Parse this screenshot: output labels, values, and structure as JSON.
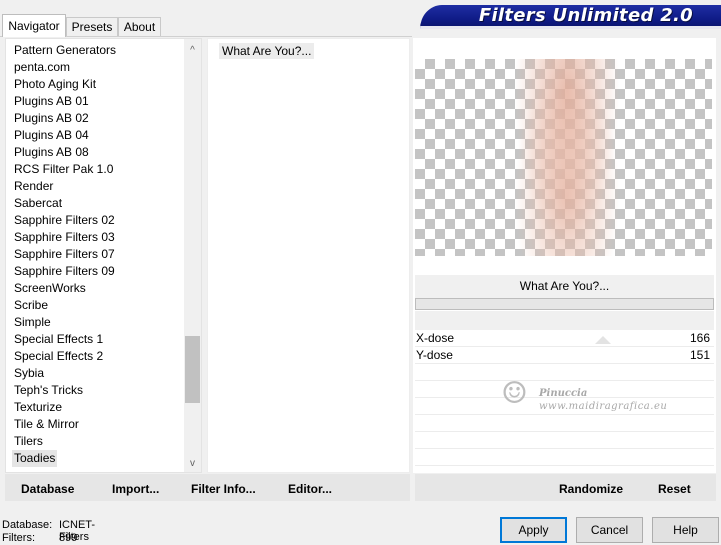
{
  "tabs": [
    {
      "label": "Navigator",
      "active": true
    },
    {
      "label": "Presets",
      "active": false
    },
    {
      "label": "About",
      "active": false
    }
  ],
  "banner": {
    "title": "Filters Unlimited 2.0"
  },
  "categories": {
    "items": [
      "Pattern Generators",
      "penta.com",
      "Photo Aging Kit",
      "Plugins AB 01",
      "Plugins AB 02",
      "Plugins AB 04",
      "Plugins AB 08",
      "RCS Filter Pak 1.0",
      "Render",
      "Sabercat",
      "Sapphire Filters 02",
      "Sapphire Filters 03",
      "Sapphire Filters 07",
      "Sapphire Filters 09",
      "ScreenWorks",
      "Scribe",
      "Simple",
      "Special Effects 1",
      "Special Effects 2",
      "Sybia",
      "Teph's Tricks",
      "Texturize",
      "Tile & Mirror",
      "Tilers",
      "Toadies"
    ],
    "selected": "Toadies",
    "scroll_up_glyph": "^",
    "scroll_down_glyph": "v"
  },
  "filters": {
    "items": [
      "What Are You?..."
    ],
    "selected": "What Are You?..."
  },
  "preview": {
    "checker_color": "#c4c4c4",
    "tint_color": "#e2aa96"
  },
  "selected_filter_name": "What Are You?...",
  "progress": {
    "fraction": 0.0,
    "fill_color": "#06b025"
  },
  "params": [
    {
      "label": "X-dose",
      "value": "166"
    },
    {
      "label": "Y-dose",
      "value": "151"
    }
  ],
  "watermark": {
    "name": "Pinuccia",
    "url": "www.maidiragrafica.eu",
    "logo_glyph": "☺"
  },
  "left_buttons": {
    "database": "Database",
    "import": "Import...",
    "filter_info": "Filter Info...",
    "editor": "Editor..."
  },
  "right_buttons": {
    "randomize": "Randomize",
    "reset": "Reset"
  },
  "status": {
    "database_label": "Database:",
    "database_value": "ICNET-Filters",
    "filters_label": "Filters:",
    "filters_value": "899"
  },
  "dialog_buttons": {
    "apply": "Apply",
    "cancel": "Cancel",
    "help": "Help"
  },
  "colors": {
    "banner": "#0f1b86",
    "default_button_border": "#0078d7",
    "selection": "#e5e5e5"
  }
}
